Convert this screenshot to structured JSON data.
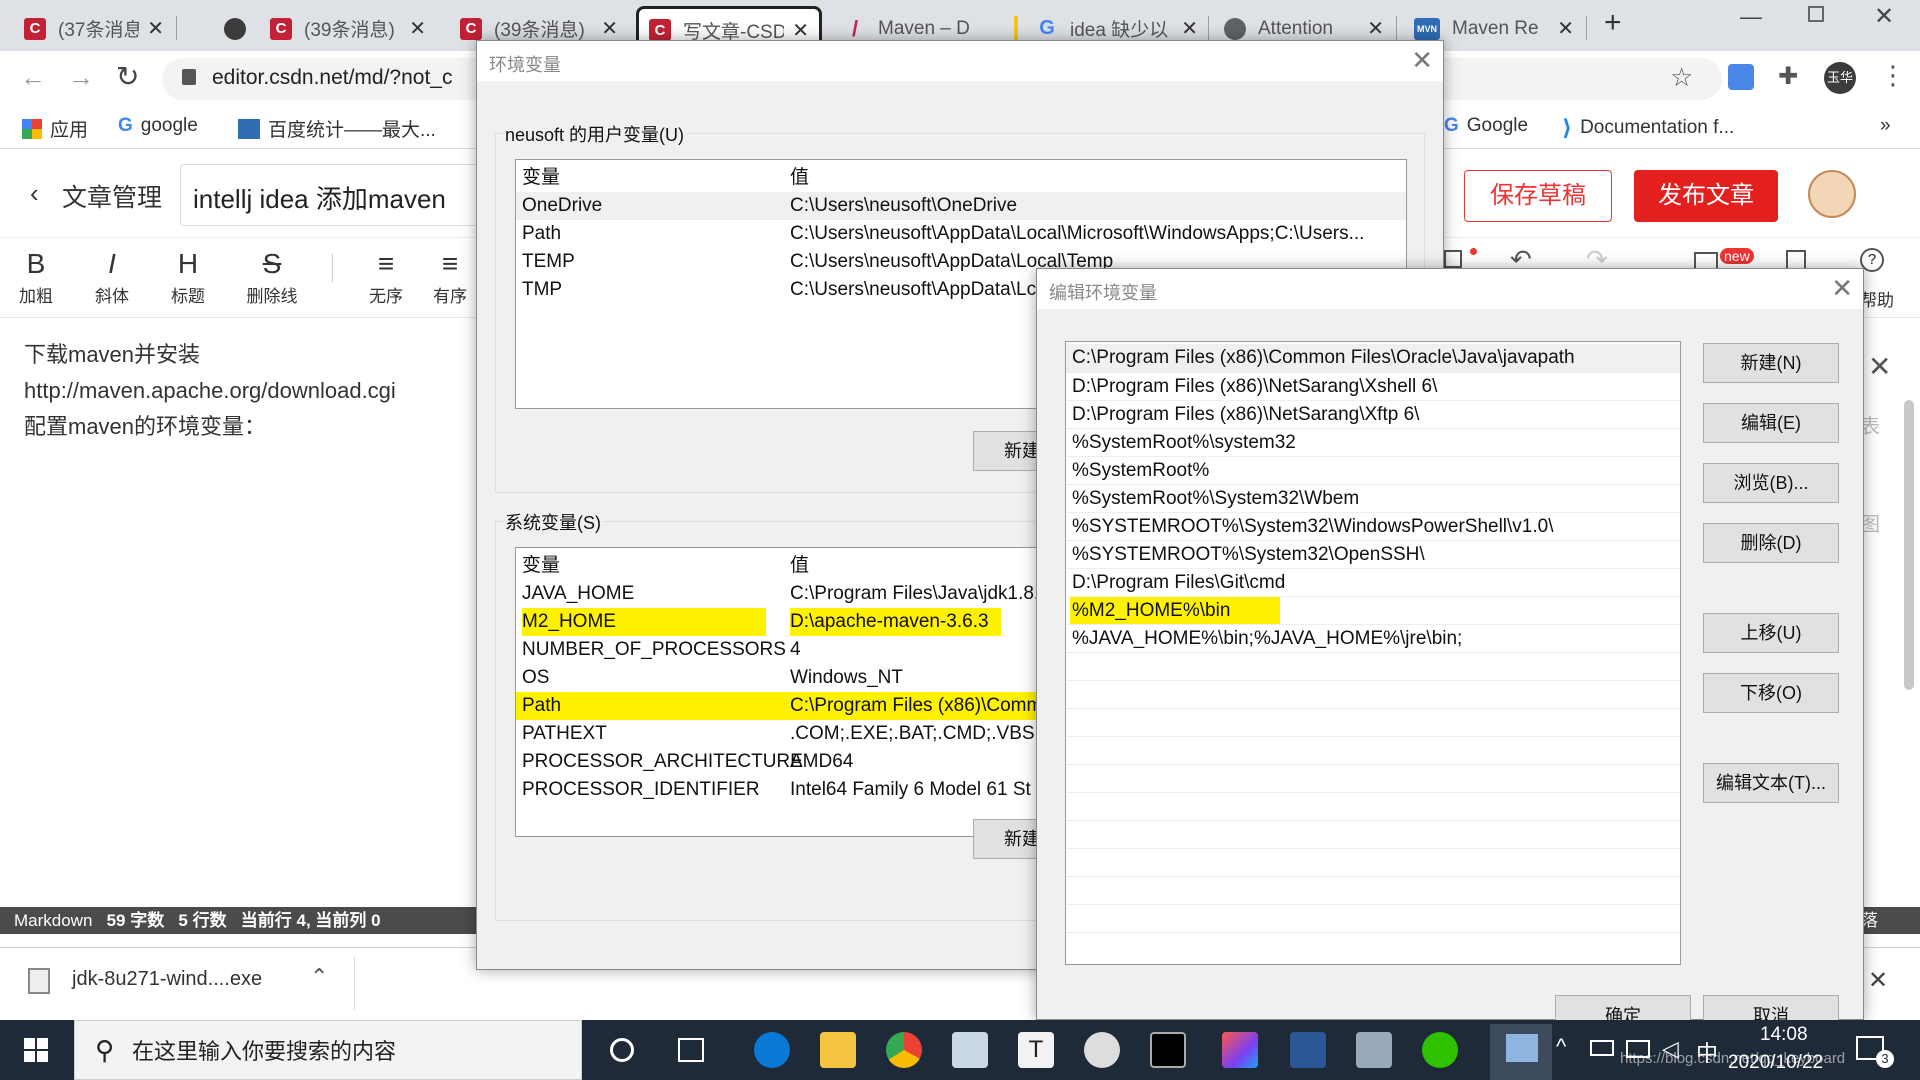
{
  "browser": {
    "tabs": [
      {
        "label": "(37条消息)(",
        "favicon": "C",
        "color": "#c32136"
      },
      {
        "label": "",
        "favicon": "",
        "color": "#3c3c3c"
      },
      {
        "label": "(39条消息)",
        "favicon": "C",
        "color": "#c32136"
      },
      {
        "label": "(39条消息)",
        "favicon": "C",
        "color": "#c32136"
      },
      {
        "label": "写文章-CSD",
        "favicon": "C",
        "color": "#c32136"
      },
      {
        "label": "Maven – D",
        "favicon": "/",
        "color": "#c7254e"
      },
      {
        "label": "idea 缺少以",
        "favicon": "G",
        "color": "#4285f4"
      },
      {
        "label": "Attention",
        "favicon": "",
        "color": "#5f6368"
      },
      {
        "label": "Maven Re",
        "favicon": "MVN",
        "color": "#2f6db5"
      }
    ],
    "close_glyph": "✕",
    "new_tab_glyph": "+",
    "url": "editor.csdn.net/md/?not_c",
    "profile_label": "玉华",
    "bookmarks": [
      {
        "label": "应用"
      },
      {
        "label": "google"
      },
      {
        "label": "百度统计——最大..."
      },
      {
        "label": "Google"
      },
      {
        "label": "Documentation f..."
      }
    ],
    "more_bookmarks": "»"
  },
  "csdn": {
    "back_label": "文章管理",
    "article_title": "intellj idea 添加maven",
    "save_draft": "保存草稿",
    "publish": "发布文章",
    "new_badge": "new",
    "help_label": "帮助",
    "toolbar": [
      {
        "glyph": "B",
        "label": "加粗"
      },
      {
        "glyph": "I",
        "label": "斜体"
      },
      {
        "glyph": "H",
        "label": "标题"
      },
      {
        "glyph": "S",
        "label": "删除线"
      },
      {
        "glyph": "≡",
        "label": "无序"
      },
      {
        "glyph": "≡",
        "label": "有序"
      }
    ],
    "editor_lines": [
      "下载maven并安装",
      "http://maven.apache.org/download.cgi",
      "配置maven的环境变量："
    ],
    "status": {
      "mode": "Markdown",
      "chars": "59 字数",
      "lines": "5 行数",
      "cursor": "当前行 4, 当前列 0",
      "right": "段落"
    },
    "right_panel": {
      "a": "表",
      "b": "图"
    }
  },
  "downloads": {
    "file": "jdk-8u271-wind....exe"
  },
  "env_dialog": {
    "title": "环境变量",
    "user_group": "neusoft 的用户变量(U)",
    "sys_group": "系统变量(S)",
    "col_var": "变量",
    "col_val": "值",
    "user_vars": [
      {
        "name": "OneDrive",
        "value": "C:\\Users\\neusoft\\OneDrive",
        "highlight": false
      },
      {
        "name": "Path",
        "value": "C:\\Users\\neusoft\\AppData\\Local\\Microsoft\\WindowsApps;C:\\Users...",
        "highlight": false
      },
      {
        "name": "TEMP",
        "value": "C:\\Users\\neusoft\\AppData\\Local\\Temp",
        "highlight": false
      },
      {
        "name": "TMP",
        "value": "C:\\Users\\neusoft\\AppData\\Lc",
        "highlight": false
      }
    ],
    "sys_vars": [
      {
        "name": "JAVA_HOME",
        "value": "C:\\Program Files\\Java\\jdk1.8.",
        "highlight": false
      },
      {
        "name": "M2_HOME",
        "value": "D:\\apache-maven-3.6.3",
        "highlight": true
      },
      {
        "name": "NUMBER_OF_PROCESSORS",
        "value": "4",
        "highlight": false
      },
      {
        "name": "OS",
        "value": "Windows_NT",
        "highlight": false
      },
      {
        "name": "Path",
        "value": "C:\\Program Files (x86)\\Comm",
        "highlight": true
      },
      {
        "name": "PATHEXT",
        "value": ".COM;.EXE;.BAT;.CMD;.VBS;.VI",
        "highlight": false
      },
      {
        "name": "PROCESSOR_ARCHITECTURE",
        "value": "AMD64",
        "highlight": false
      },
      {
        "name": "PROCESSOR_IDENTIFIER",
        "value": "Intel64 Family 6 Model 61 St",
        "highlight": false
      }
    ],
    "new_user": "新建",
    "new_sys": "新建"
  },
  "edit_dialog": {
    "title": "编辑环境变量",
    "entries": [
      {
        "value": "C:\\Program Files (x86)\\Common Files\\Oracle\\Java\\javapath",
        "highlight": false
      },
      {
        "value": "D:\\Program Files (x86)\\NetSarang\\Xshell 6\\",
        "highlight": false
      },
      {
        "value": "D:\\Program Files (x86)\\NetSarang\\Xftp 6\\",
        "highlight": false
      },
      {
        "value": "%SystemRoot%\\system32",
        "highlight": false
      },
      {
        "value": "%SystemRoot%",
        "highlight": false
      },
      {
        "value": "%SystemRoot%\\System32\\Wbem",
        "highlight": false
      },
      {
        "value": "%SYSTEMROOT%\\System32\\WindowsPowerShell\\v1.0\\",
        "highlight": false
      },
      {
        "value": "%SYSTEMROOT%\\System32\\OpenSSH\\",
        "highlight": false
      },
      {
        "value": "D:\\Program Files\\Git\\cmd",
        "highlight": false
      },
      {
        "value": "%M2_HOME%\\bin",
        "highlight": true
      },
      {
        "value": "%JAVA_HOME%\\bin;%JAVA_HOME%\\jre\\bin;",
        "highlight": false
      }
    ],
    "buttons": {
      "new": "新建(N)",
      "edit": "编辑(E)",
      "browse": "浏览(B)...",
      "delete": "删除(D)",
      "up": "上移(U)",
      "down": "下移(O)",
      "edit_text": "编辑文本(T)...",
      "ok": "确定",
      "cancel": "取消"
    }
  },
  "taskbar": {
    "search_placeholder": "在这里输入你要搜索的内容",
    "ime": "中",
    "time": "14:08",
    "date": "2020/10/22",
    "watermark": "https://blog.csdn.net/qq_keyboard",
    "notifications": "3"
  }
}
